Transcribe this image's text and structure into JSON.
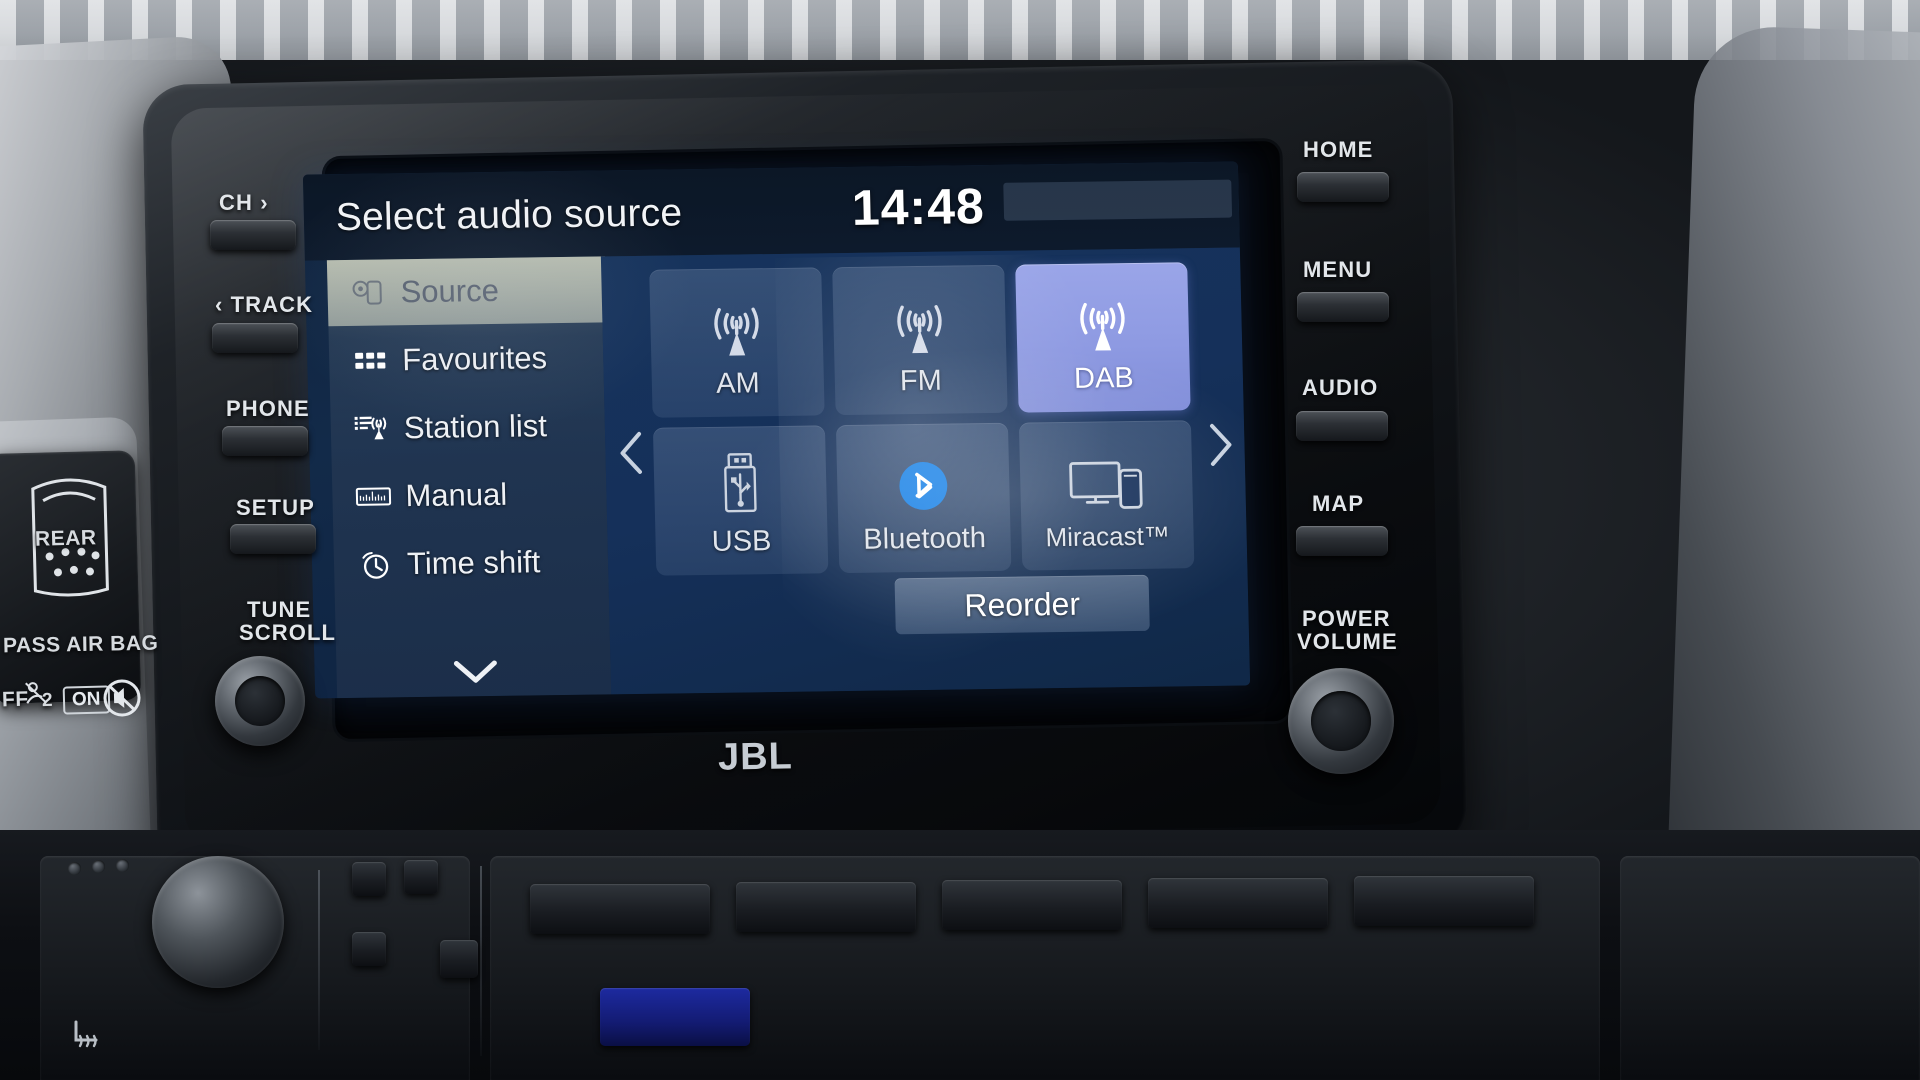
{
  "screen": {
    "title": "Select audio source",
    "clock": "14:48"
  },
  "sidebar": {
    "items": [
      {
        "label": "Source",
        "icon": "source-icon",
        "selected": true
      },
      {
        "label": "Favourites",
        "icon": "grid-icon",
        "selected": false
      },
      {
        "label": "Station list",
        "icon": "station-list-icon",
        "selected": false
      },
      {
        "label": "Manual",
        "icon": "tuning-scale-icon",
        "selected": false
      },
      {
        "label": "Time shift",
        "icon": "clock-icon",
        "selected": false
      }
    ],
    "more_icon": "chevron-down-icon"
  },
  "source_grid": {
    "prev_icon": "chevron-left-icon",
    "next_icon": "chevron-right-icon",
    "tiles": [
      {
        "label": "AM",
        "icon": "radio-tower-icon",
        "active": false
      },
      {
        "label": "FM",
        "icon": "radio-tower-icon",
        "active": false
      },
      {
        "label": "DAB",
        "icon": "radio-tower-icon",
        "active": true
      },
      {
        "label": "USB",
        "icon": "usb-drive-icon",
        "active": false
      },
      {
        "label": "Bluetooth",
        "icon": "bluetooth-icon",
        "active": false
      },
      {
        "label": "Miracast™",
        "icon": "screen-cast-icon",
        "active": false
      }
    ],
    "reorder_label": "Reorder"
  },
  "hardware": {
    "left_controls": [
      {
        "label": "CH ›"
      },
      {
        "label": "‹ TRACK"
      },
      {
        "label": "PHONE"
      },
      {
        "label": "SETUP"
      }
    ],
    "tune_scroll": {
      "line1": "TUNE",
      "line2": "SCROLL"
    },
    "right_controls": [
      {
        "label": "HOME"
      },
      {
        "label": "MENU"
      },
      {
        "label": "AUDIO"
      },
      {
        "label": "MAP"
      }
    ],
    "power_volume": {
      "line1": "POWER",
      "line2": "VOLUME"
    },
    "brand_badge": "JBL"
  },
  "airbag": {
    "rear_label": "REAR",
    "title": "PASS AIR BAG",
    "off_label": "FF",
    "count_label": "2",
    "on_label": "ON"
  },
  "colors": {
    "screen_bg": "#13305a",
    "title_bar": "#0d1a2c",
    "tile_bg": "#5f789b",
    "tile_active": "#8e9ae2",
    "bluetooth_blue": "#0b7ae5",
    "sidebar_selected": "#d6d9c4",
    "text_primary": "#f2f4f7"
  }
}
